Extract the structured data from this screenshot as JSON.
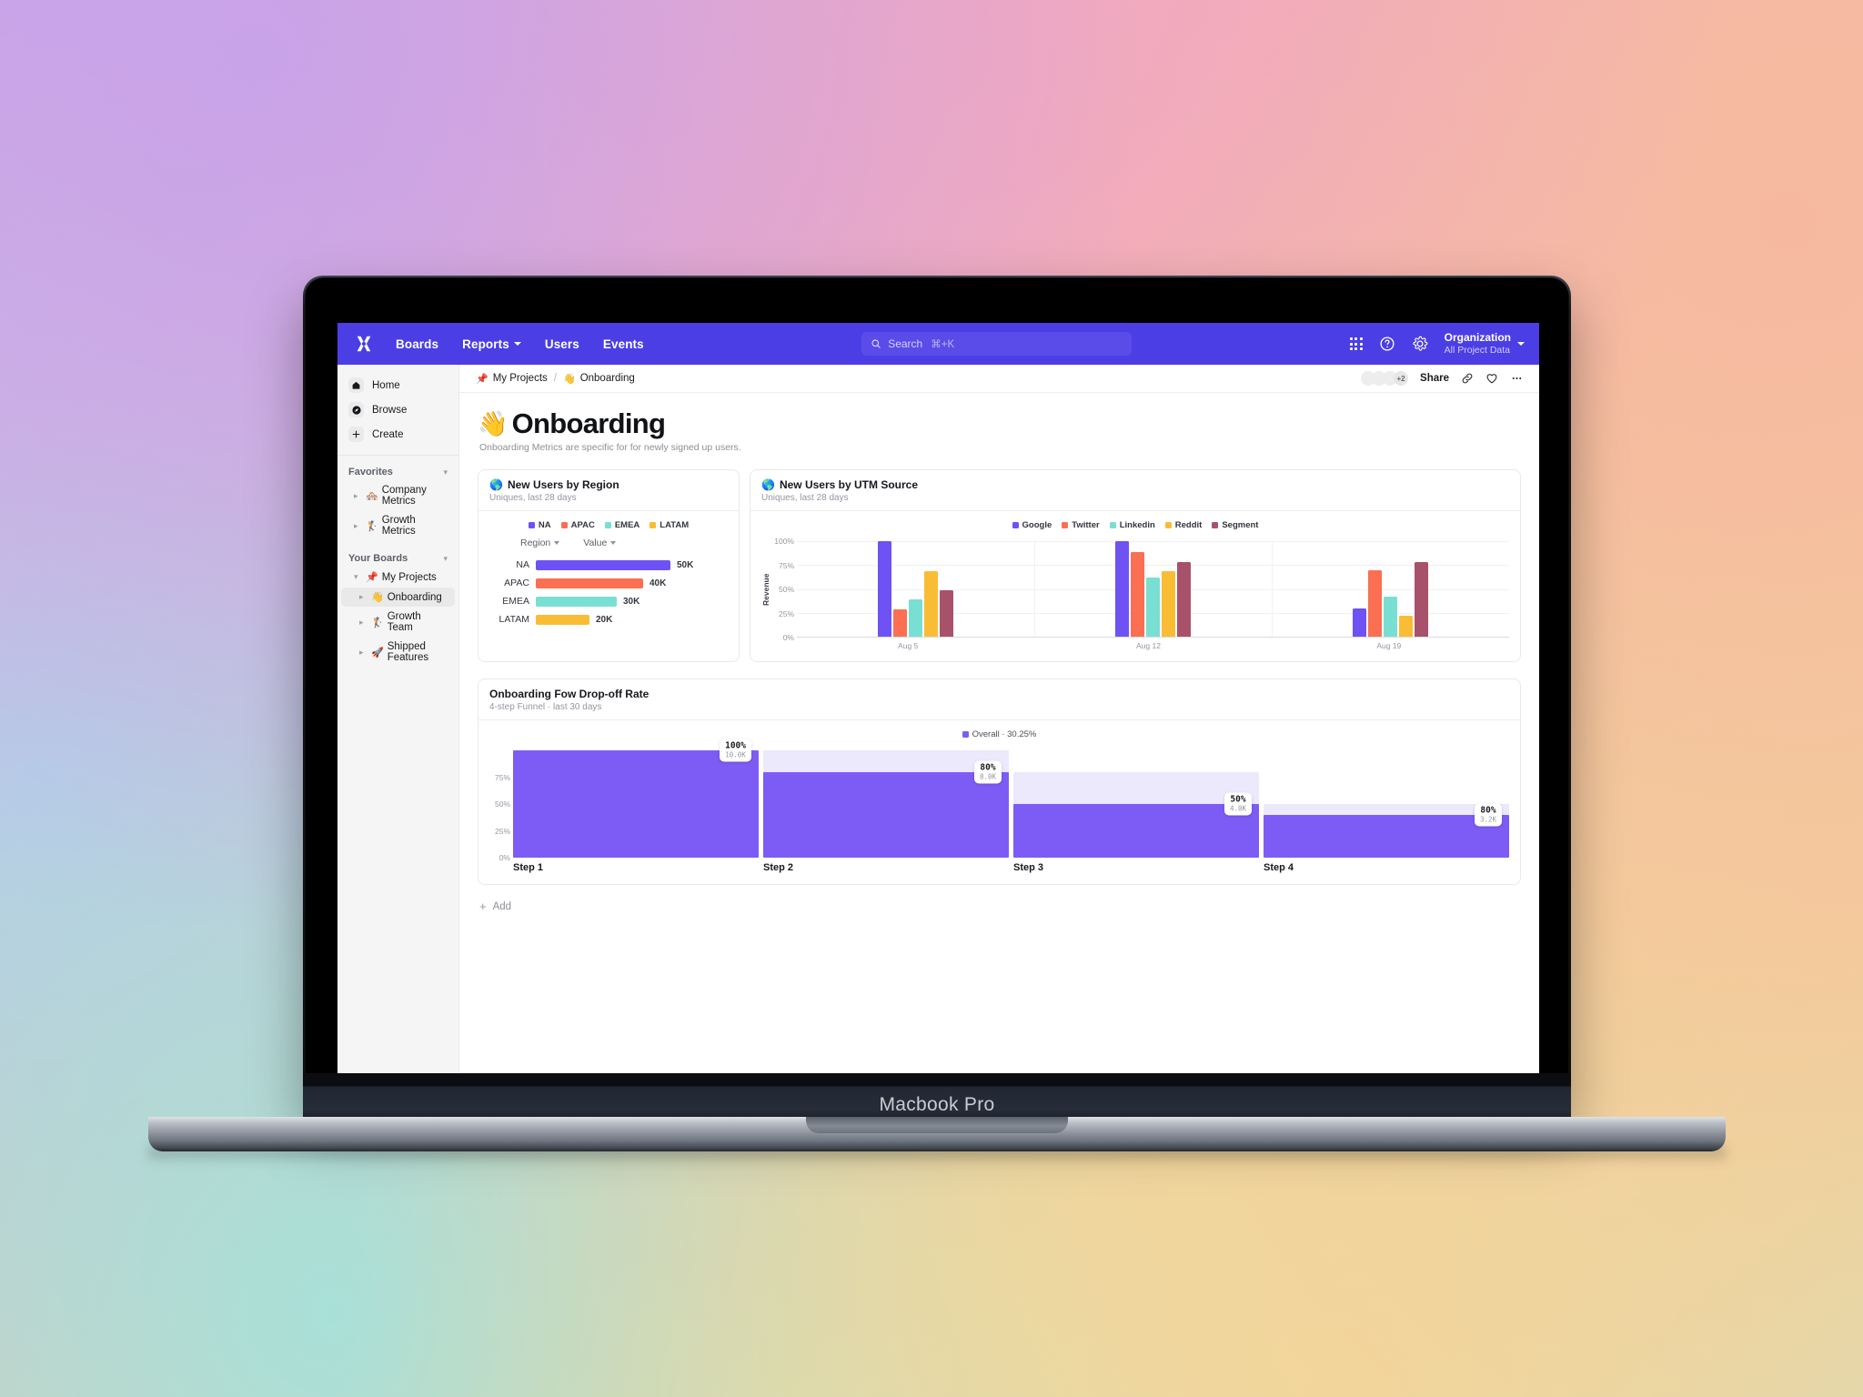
{
  "device": {
    "label": "Macbook Pro"
  },
  "topnav": {
    "logo_icon": "x-logo-icon",
    "links": [
      {
        "label": "Boards",
        "has_caret": false
      },
      {
        "label": "Reports",
        "has_caret": true
      },
      {
        "label": "Users",
        "has_caret": false
      },
      {
        "label": "Events",
        "has_caret": false
      }
    ],
    "search": {
      "placeholder": "Search",
      "shortcut": "⌘+K",
      "icon": "search-icon"
    },
    "apps_icon": "grid-apps-icon",
    "help_icon": "question-circle-icon",
    "settings_icon": "gear-icon",
    "org": {
      "name": "Organization",
      "scope": "All Project Data"
    }
  },
  "sidebar": {
    "primary": [
      {
        "label": "Home",
        "icon": "home-icon"
      },
      {
        "label": "Browse",
        "icon": "compass-icon"
      },
      {
        "label": "Create",
        "icon": "plus-icon"
      }
    ],
    "sections": [
      {
        "label": "Favorites",
        "items": [
          {
            "label": "Company Metrics",
            "emoji": "🏘️"
          },
          {
            "label": "Growth Metrics",
            "emoji": "🏌️"
          }
        ]
      },
      {
        "label": "Your Boards",
        "root": {
          "label": "My Projects",
          "emoji": "📌"
        },
        "items": [
          {
            "label": "Onboarding",
            "emoji": "👋",
            "active": true
          },
          {
            "label": "Growth Team",
            "emoji": "🏌️",
            "active": false
          },
          {
            "label": "Shipped Features",
            "emoji": "🚀",
            "active": false
          }
        ]
      }
    ]
  },
  "breadcrumb": {
    "parent": {
      "label": "My Projects",
      "emoji": "📌"
    },
    "separator": "/",
    "current": {
      "label": "Onboarding",
      "emoji": "👋"
    },
    "avatar_overflow": "+2",
    "share_label": "Share",
    "link_icon": "link-icon",
    "favorite_icon": "heart-icon",
    "more_icon": "ellipsis-icon"
  },
  "page": {
    "emoji": "👋",
    "title": "Onboarding",
    "subtitle": "Onboarding Metrics are specific for for newly signed up users.",
    "add_label": "Add"
  },
  "colors": {
    "brand": "#4b3ee4",
    "funnel_fill": "#7d5cf5",
    "funnel_ghost": "#ece9fd",
    "na": "#6e52f4",
    "apac": "#fb6f52",
    "emea": "#79dfd2",
    "latam": "#f9bd35",
    "segment": "#a8516b"
  },
  "chart_data": [
    {
      "id": "new-users-by-region",
      "type": "bar",
      "orientation": "horizontal",
      "title": "New Users by Region",
      "title_emoji": "🌎",
      "subtitle": "Uniques, last 28 days",
      "legend": [
        {
          "label": "NA",
          "color": "#6e52f4"
        },
        {
          "label": "APAC",
          "color": "#fb6f52"
        },
        {
          "label": "EMEA",
          "color": "#79dfd2"
        },
        {
          "label": "LATAM",
          "color": "#f9bd35"
        }
      ],
      "columns": [
        "Region",
        "Value"
      ],
      "categories": [
        "NA",
        "APAC",
        "EMEA",
        "LATAM"
      ],
      "values": [
        50000,
        40000,
        30000,
        20000
      ],
      "value_labels": [
        "50K",
        "40K",
        "30K",
        "20K"
      ],
      "colors": [
        "#6e52f4",
        "#fb6f52",
        "#79dfd2",
        "#f9bd35"
      ],
      "xlabel": "",
      "ylabel": "",
      "grid": false
    },
    {
      "id": "new-users-by-utm-source",
      "type": "bar",
      "orientation": "vertical",
      "title": "New Users by UTM Source",
      "title_emoji": "🌎",
      "subtitle": "Uniques, last 28 days",
      "ylabel": "Revenue",
      "xlabel": "",
      "ylim": [
        0,
        100
      ],
      "yticks": [
        "0%",
        "25%",
        "50%",
        "75%",
        "100%"
      ],
      "categories": [
        "Aug 5",
        "Aug 12",
        "Aug 19"
      ],
      "grid": true,
      "legend_position": "top-right",
      "series": [
        {
          "name": "Google",
          "color": "#6e52f4",
          "values": [
            100,
            100,
            30
          ]
        },
        {
          "name": "Twitter",
          "color": "#fb6f52",
          "values": [
            29,
            89,
            70
          ]
        },
        {
          "name": "Linkedin",
          "color": "#79dfd2",
          "values": [
            39,
            62,
            42
          ]
        },
        {
          "name": "Reddit",
          "color": "#f9bd35",
          "values": [
            69,
            69,
            22
          ]
        },
        {
          "name": "Segment",
          "color": "#a8516b",
          "values": [
            49,
            78,
            78
          ]
        }
      ]
    },
    {
      "id": "onboarding-flow-drop-off-rate",
      "type": "bar",
      "chart_kind": "funnel",
      "title": "Onboarding Fow Drop-off Rate",
      "subtitle": "4-step Funnel · last 30 days",
      "legend": [
        {
          "label": "Overall · 30.25%",
          "color": "#7d5cf5"
        }
      ],
      "ylim": [
        0,
        100
      ],
      "yticks": [
        "0%",
        "25%",
        "50%",
        "75%"
      ],
      "categories": [
        "Step 1",
        "Step 2",
        "Step 3",
        "Step 4"
      ],
      "values": [
        100,
        80,
        50,
        80
      ],
      "pct_labels": [
        "100%",
        "80%",
        "50%",
        "80%"
      ],
      "count_labels": [
        "10.0K",
        "8.0K",
        "4.0K",
        "3.2K"
      ],
      "ghost_values": [
        100,
        100,
        80,
        50
      ],
      "grid": true
    }
  ]
}
